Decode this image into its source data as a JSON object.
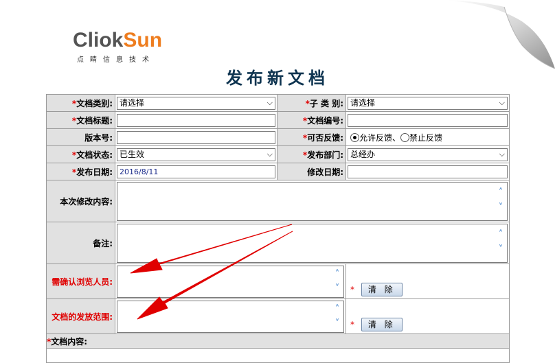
{
  "logo": {
    "click": "Cli",
    "o": "o",
    "k": "k",
    "sun": "Sun",
    "sub": "点睛信息技术"
  },
  "page_title": "发布新文档",
  "required_mark": "*",
  "form": {
    "doc_type": {
      "label": "文档类别:",
      "value": "请选择"
    },
    "sub_type": {
      "label": "子 类 别:",
      "value": "请选择"
    },
    "doc_title": {
      "label": "文档标题:",
      "value": ""
    },
    "doc_number": {
      "label": "文档编号:",
      "value": ""
    },
    "version": {
      "label": "版本号:",
      "value": ""
    },
    "feedback": {
      "label": "可否反馈:",
      "option_allow": "允许反馈、",
      "option_deny": "禁止反馈"
    },
    "doc_status": {
      "label": "文档状态:",
      "value": "已生效"
    },
    "department": {
      "label": "发布部门:",
      "value": "总经办"
    },
    "publish_date": {
      "label": "发布日期:",
      "value": "2016/8/11"
    },
    "modify_date": {
      "label": "修改日期:",
      "value": ""
    },
    "change_content": {
      "label": "本次修改内容:"
    },
    "remark": {
      "label": "备注:"
    },
    "confirm_readers": {
      "label": "需确认浏览人员:",
      "clear_label": "清 除"
    },
    "distribution": {
      "label": "文档的发放范围:",
      "clear_label": "清 除"
    },
    "doc_content": {
      "label": "文档内容:"
    }
  },
  "icons": {
    "dropdown": "chevron-down-icon",
    "scroll_up": "scroll-up-icon",
    "scroll_down": "scroll-down-icon"
  },
  "colors": {
    "label_bg": "#e1e1e1",
    "required": "#e00000",
    "title": "#0e3450",
    "logo_orange": "#ee7d1f",
    "arrow_red": "#e00000"
  }
}
